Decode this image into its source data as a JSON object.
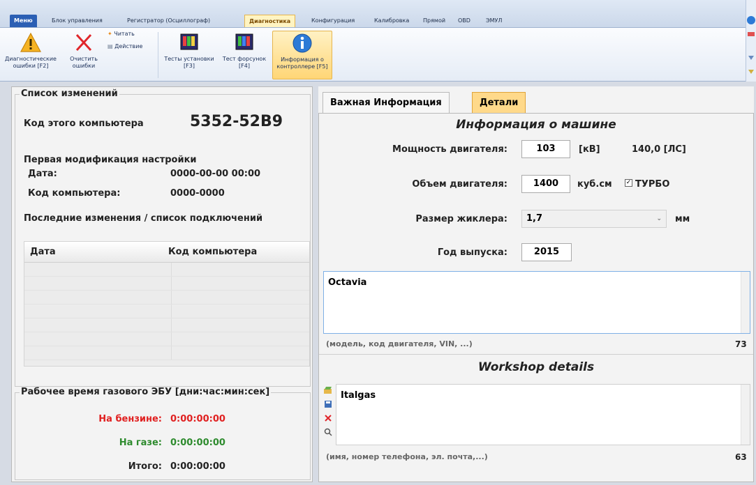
{
  "ribbon": {
    "tabs": [
      "Меню",
      "Блок управления",
      "Регистратор (Осциллограф)",
      "Диагностика",
      "Конфигурация",
      "Калибровка",
      "Прямой",
      "OBD",
      "ЭМУЛ"
    ],
    "active_tab": "Диагностика",
    "buttons": {
      "diag_errors": "Диагностические ошибки [F2]",
      "clear_errors": "Очистить ошибки",
      "read": "Читать",
      "action": "Действие",
      "install_tests": "Тесты установки [F3]",
      "injector_test": "Тест форсунок [F4]",
      "controller_info": "Информация о контроллере [F5]"
    }
  },
  "left": {
    "changes_title": "Список изменений",
    "computer_code_label": "Код этого компьютера",
    "computer_code_value": "5352-52B9",
    "first_mod_title": "Первая модификация настройки",
    "date_label": "Дата:",
    "date_value": "0000-00-00 00:00",
    "pc_code_label": "Код компьютера:",
    "pc_code_value": "0000-0000",
    "history_title": "Последние изменения / список подключений",
    "table_headers": [
      "Дата",
      "Код компьютера"
    ],
    "runtime_title": "Рабочее время газового ЭБУ [дни:час:мин:сек]",
    "runtime": {
      "petrol_label": "На бензине:",
      "petrol_value": "0:00:00:00",
      "gas_label": "На газе:",
      "gas_value": "0:00:00:00",
      "total_label": "Итого:",
      "total_value": "0:00:00:00"
    },
    "colors": {
      "petrol": "#e02020",
      "gas": "#2e8b2e"
    }
  },
  "right": {
    "tabs": [
      "Важная Информация",
      "Детали"
    ],
    "active_tab": "Детали",
    "machine_title": "Информация о машине",
    "engine_power_label": "Мощность двигателя:",
    "engine_power_value": "103",
    "engine_power_unit": "[кВ]",
    "engine_power_hp": "140,0  [ЛС]",
    "engine_volume_label": "Объем двигателя:",
    "engine_volume_value": "1400",
    "engine_volume_unit": "куб.см",
    "turbo_label": "ТУРБО",
    "jet_size_label": "Размер жиклера:",
    "jet_size_value": "1,7",
    "jet_size_unit": "мм",
    "year_label": "Год выпуска:",
    "year_value": "2015",
    "model_text": "Octavia",
    "model_hint": "(модель, код двигателя, VIN, ...)",
    "model_count": "73",
    "workshop_title": "Workshop details",
    "workshop_text": "Italgas",
    "workshop_hint": "(имя, номер телефона, эл. почта,...)",
    "workshop_count": "63"
  }
}
